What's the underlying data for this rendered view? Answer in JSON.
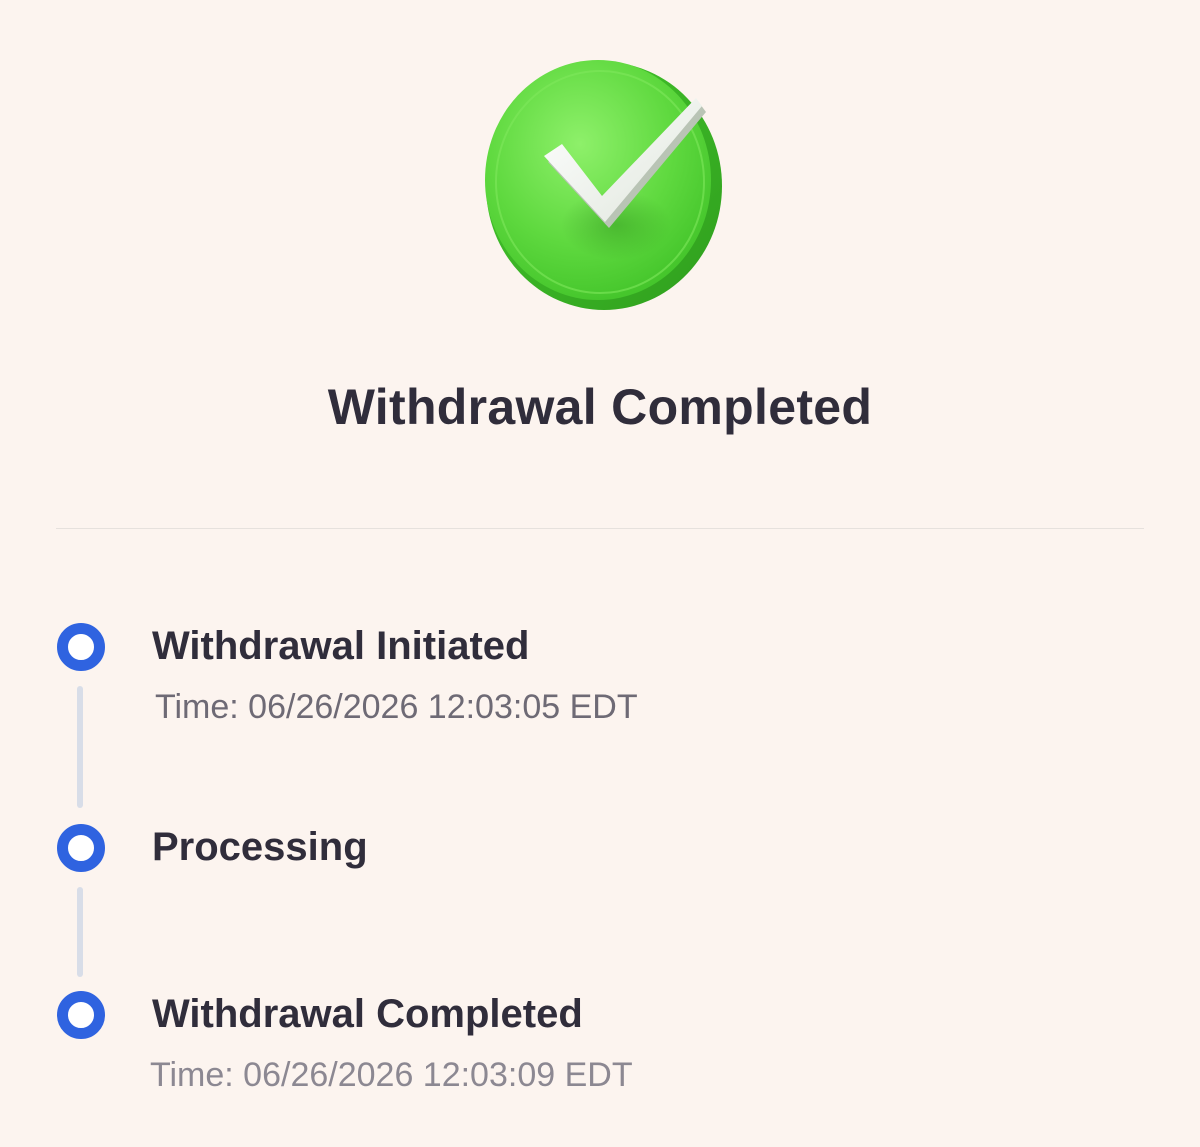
{
  "page": {
    "title": "Withdrawal Completed",
    "hero_icon": "check-circle-icon",
    "accent_color": "#2f63e0",
    "success_color": "#3fcf2c",
    "background_color": "#fcf4ef"
  },
  "timeline": {
    "steps": [
      {
        "title": "Withdrawal Initiated",
        "time": "Time: 06/26/2026 12:03:05 EDT",
        "icon": "timeline-dot-icon"
      },
      {
        "title": "Processing",
        "time": "",
        "icon": "timeline-dot-icon"
      },
      {
        "title": "Withdrawal Completed",
        "time": "Time: 06/26/2026 12:03:09 EDT",
        "icon": "timeline-dot-icon"
      }
    ]
  }
}
